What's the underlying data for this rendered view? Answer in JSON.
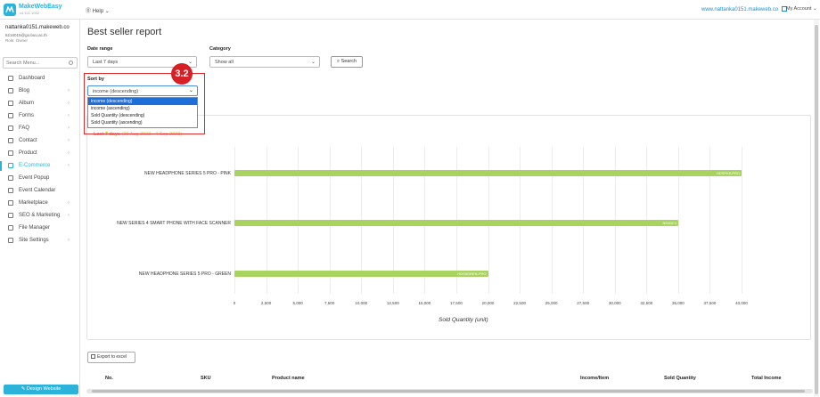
{
  "app": {
    "logo_name": "MakeWebEasy",
    "logo_version": "v4.101.1002",
    "help_label": "Help",
    "site_link": "www.nattanka0151.makeweb.co",
    "account_label": "My Account"
  },
  "user": {
    "name": "nattanka0151.makeweb.co",
    "email": "6216015@go.buu.ac.th",
    "role": "Role: Owner"
  },
  "sidebar": {
    "search_placeholder": "Search Menu...",
    "items": [
      {
        "label": "Dashboard",
        "icon": "home-icon",
        "has_arrow": false
      },
      {
        "label": "Blog",
        "icon": "document-icon",
        "has_arrow": true
      },
      {
        "label": "Album",
        "icon": "image-icon",
        "has_arrow": true
      },
      {
        "label": "Forms",
        "icon": "list-icon",
        "has_arrow": true
      },
      {
        "label": "FAQ",
        "icon": "question-icon",
        "has_arrow": true
      },
      {
        "label": "Contact",
        "icon": "mail-icon",
        "has_arrow": true
      },
      {
        "label": "Product",
        "icon": "cart-icon",
        "has_arrow": true
      },
      {
        "label": "E-Commerce",
        "icon": "shop-icon",
        "has_arrow": true,
        "active": true
      },
      {
        "label": "Event Popup",
        "icon": "popup-icon",
        "has_arrow": false
      },
      {
        "label": "Event Calendar",
        "icon": "calendar-icon",
        "has_arrow": false
      },
      {
        "label": "Marketplace",
        "icon": "store-icon",
        "has_arrow": true
      },
      {
        "label": "SEO & Marketing",
        "icon": "search-icon",
        "has_arrow": true
      },
      {
        "label": "File Manager",
        "icon": "folder-icon",
        "has_arrow": false
      },
      {
        "label": "Site Settings",
        "icon": "gear-icon",
        "has_arrow": true
      }
    ],
    "design_button": "Design Website"
  },
  "page": {
    "title": "Best seller report",
    "date_range_label": "Date range",
    "date_range_value": "Last 7 days",
    "category_label": "Category",
    "category_value": "Show all",
    "search_button": "Search",
    "sort_by_label": "Sort by",
    "sort_by_value": "income (descending)",
    "sort_options": [
      "income (descending)",
      "income (ascending)",
      "Sold Quantity (descending)",
      "Sold Quantity (ascending)"
    ],
    "callout_number": "3.2",
    "chart_range_prefix": "Last 7 days",
    "chart_range_dates": "(29 Aug 2023 - 4 Sep 2023)",
    "export_button": "Export to excel"
  },
  "table": {
    "headers": [
      "No.",
      "SKU",
      "Product name",
      "Income/Item",
      "Sold Quantity",
      "Total Income"
    ]
  },
  "chart_data": {
    "type": "bar",
    "orientation": "horizontal",
    "categories": [
      "NEW HEADPHONE SERIES 5 PRO - PINK",
      "NEW SERIES 4 SMART PHONE WITH FACE SCANNER",
      "NEW HEADPHONE SERIES 5 PRO - GREEN"
    ],
    "sku_labels": [
      "HDSPK5-PRO",
      "NS4DF4",
      "HDS5GREN-PRO"
    ],
    "values": [
      40000,
      35000,
      20000
    ],
    "xlabel": "Sold Quantity (unit)",
    "xlim": [
      0,
      40000
    ],
    "xticks": [
      "0",
      "2,500",
      "5,000",
      "7,500",
      "10,000",
      "12,500",
      "15,000",
      "17,500",
      "20,000",
      "22,500",
      "25,000",
      "27,500",
      "30,000",
      "32,500",
      "35,000",
      "37,500",
      "40,000"
    ],
    "bar_color": "#a8d35e",
    "grid": true
  }
}
